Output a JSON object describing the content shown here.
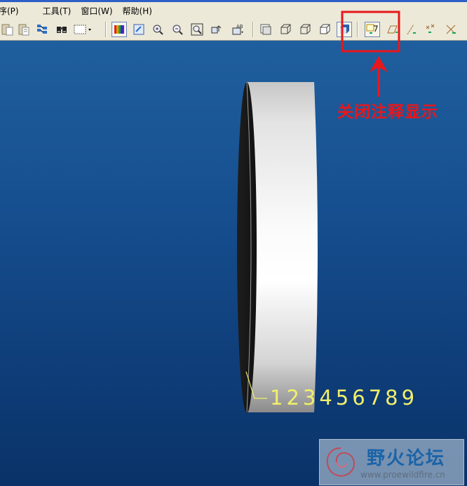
{
  "menu": {
    "items": [
      "序(P)",
      "工具(T)",
      "窗口(W)",
      "帮助(H)"
    ]
  },
  "toolbar": {
    "icons": [
      "paste-icon",
      "paste-special-icon",
      "regenerate-icon",
      "find-icon",
      "select-box-icon",
      "color-appearance-icon",
      "repaint-icon",
      "zoom-in-icon",
      "zoom-out-icon",
      "refit-icon",
      "reorient-icon",
      "saved-views-icon",
      "layers-icon",
      "wireframe-icon",
      "hidden-line-icon",
      "no-hidden-icon",
      "shading-icon",
      "annotation-display-icon",
      "datum-plane-icon",
      "datum-axis-icon",
      "datum-point-icon",
      "coordinate-system-icon"
    ],
    "highlight_color": "#e8171b"
  },
  "callout": {
    "text": "关闭注释显示"
  },
  "annotation": {
    "text": "123456789",
    "color": "#f1f06a"
  },
  "watermark": {
    "title": "野火论坛",
    "url": "www.proewildfire.cn"
  }
}
